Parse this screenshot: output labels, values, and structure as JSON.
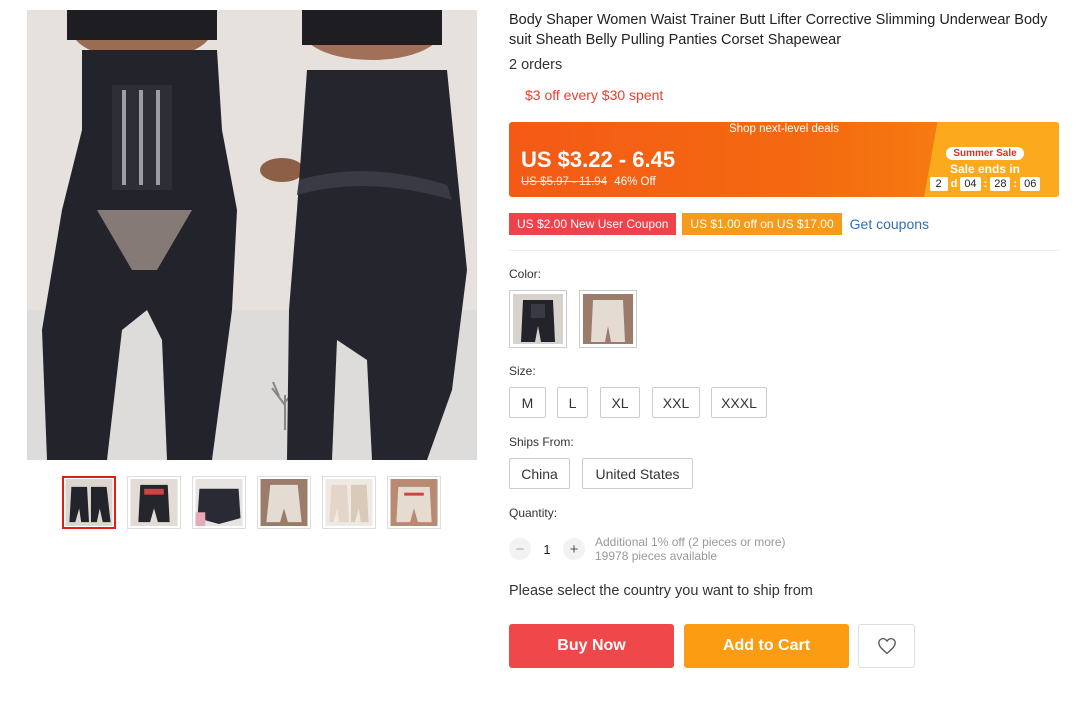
{
  "gallery": {
    "main_image_alt": "black shapewear shorts on two models",
    "thumbnails_count_label": "6",
    "colors": {
      "active_border": "#e31c1c"
    }
  },
  "product": {
    "title": "Body Shaper Women Waist Trainer Butt Lifter Corrective Slimming Underwear Body suit Sheath Belly Pulling Panties Corset Shapewear",
    "orders": "2 orders",
    "promo": "$3 off every $30 spent"
  },
  "deal": {
    "banner_title": "Shop next-level deals",
    "price": "US $3.22 - 6.45",
    "original_price": "US $5.97 - 11.94",
    "discount": "46% Off",
    "sale_tag": "Summer Sale",
    "sale_ends": "Sale ends in",
    "countdown": {
      "days": "2",
      "days_unit": "d",
      "hours": "04",
      "minutes": "28",
      "seconds": "06",
      "sep": ":"
    }
  },
  "coupons": {
    "new_user": "US $2.00 New User Coupon",
    "store": "US $1.00 off on US $17.00",
    "get": "Get coupons"
  },
  "options": {
    "color_label": "Color:",
    "size_label": "Size:",
    "sizes": [
      "M",
      "L",
      "XL",
      "XXL",
      "XXXL"
    ],
    "ships_from_label": "Ships From:",
    "ships_from": [
      "China",
      "United States"
    ],
    "quantity_label": "Quantity:",
    "quantity_value": "1",
    "quantity_minus": "−",
    "quantity_plus": "+",
    "quantity_discount": "Additional 1% off (2 pieces or more)",
    "quantity_available": "19978 pieces available"
  },
  "shipping_message": "Please select the country you want to ship from",
  "actions": {
    "buy_now": "Buy Now",
    "add_to_cart": "Add to Cart",
    "wishlist_icon": "heart-icon"
  },
  "theme": {
    "accent_red": "#f0474a",
    "accent_orange": "#fb9c12",
    "link_blue": "#2d6fbd"
  }
}
